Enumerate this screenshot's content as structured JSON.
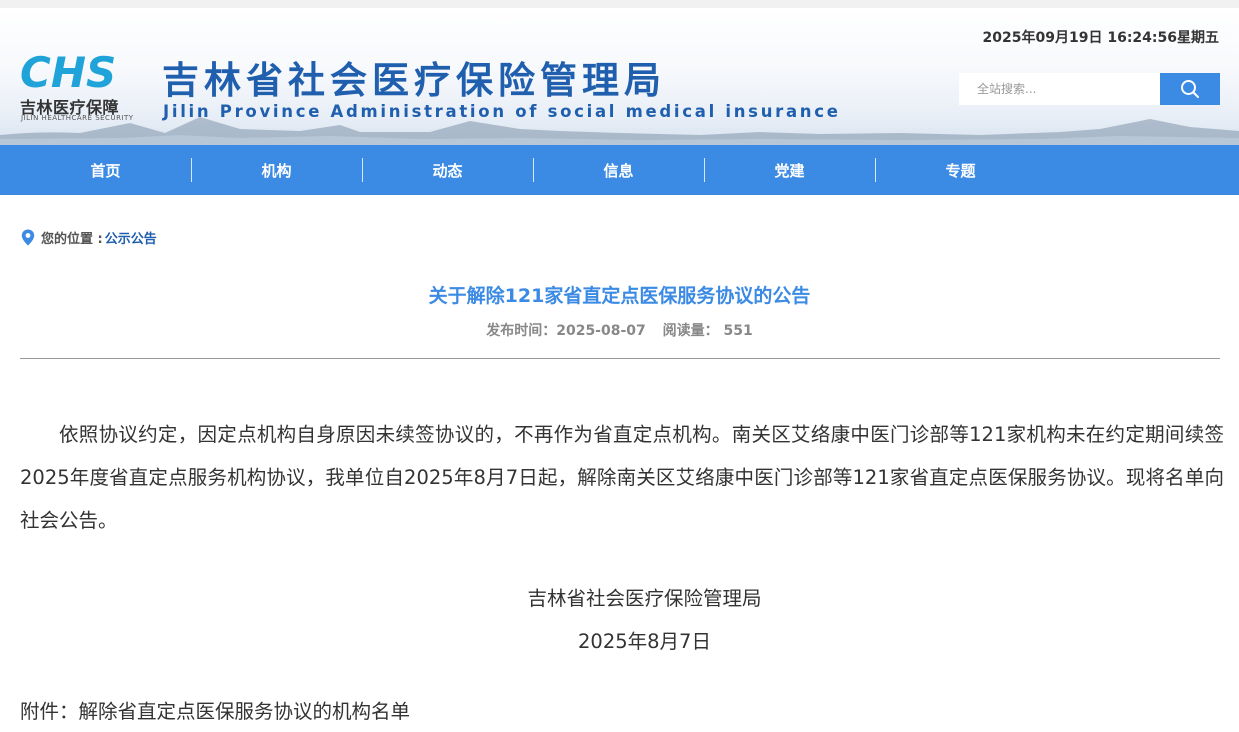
{
  "header": {
    "logo_mark": "CHS",
    "logo_text": "吉林医疗保障",
    "logo_sub": "JILIN HEALTHCARE SECURITY",
    "site_title": "吉林省社会医疗保险管理局",
    "site_title_en": "Jilin Province Administration of social medical insurance",
    "datetime": "2025年09月19日 16:24:56星期五",
    "search_placeholder": "全站搜索...",
    "search_icon": "search-icon"
  },
  "nav": {
    "items": [
      {
        "label": "首页"
      },
      {
        "label": "机构"
      },
      {
        "label": "动态"
      },
      {
        "label": "信息"
      },
      {
        "label": "党建"
      },
      {
        "label": "专题"
      }
    ]
  },
  "breadcrumb": {
    "icon": "location-pin-icon",
    "label": "您的位置 :",
    "current": "公示公告"
  },
  "article": {
    "title": "关于解除121家省直定点医保服务协议的公告",
    "publish_label": "发布时间：2025-08-07",
    "views_label": "阅读量： 551",
    "paragraph": "依照协议约定，因定点机构自身原因未续签协议的，不再作为省直定点机构。南关区艾络康中医门诊部等121家机构未在约定期间续签2025年度省直定点服务机构协议，我单位自2025年8月7日起，解除南关区艾络康中医门诊部等121家省直定点医保服务协议。现将名单向社会公告。",
    "signature": "吉林省社会医疗保险管理局",
    "date": "2025年8月7日",
    "attachment_label": "附件：",
    "attachment_link": "解除省直定点医保服务协议的机构名单"
  },
  "colors": {
    "primary": "#3b8ae4",
    "title_blue": "#1f5fae",
    "logo_cyan": "#1fa3d9"
  }
}
